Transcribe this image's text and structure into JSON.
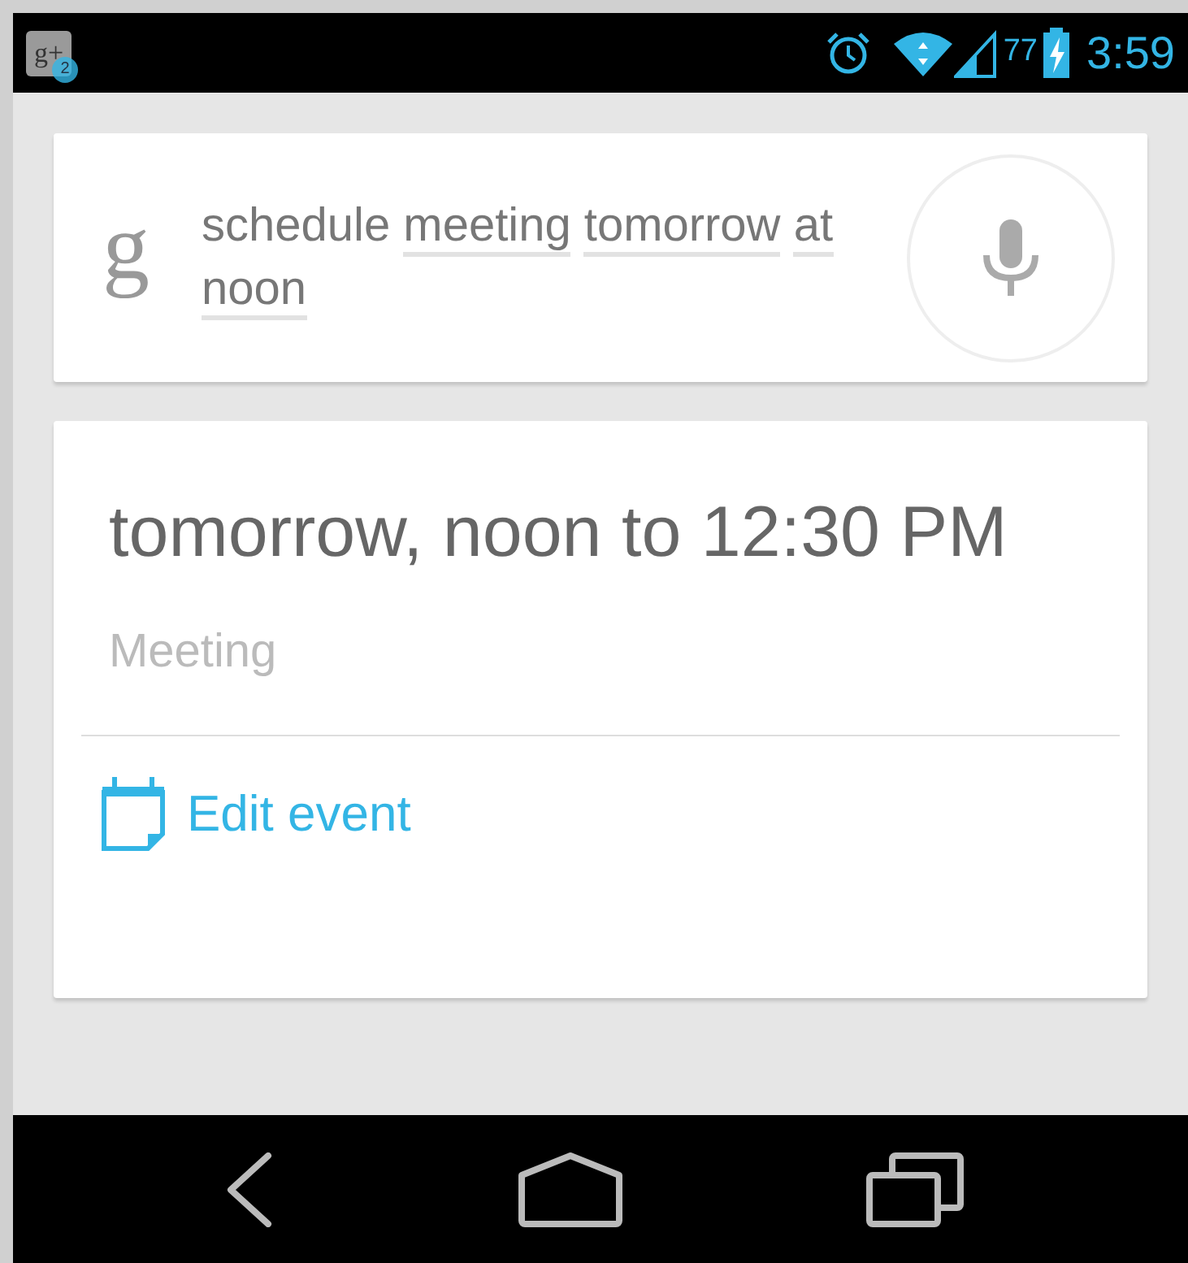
{
  "status_bar": {
    "notification": {
      "label": "g+",
      "count": "2"
    },
    "battery": "77",
    "time": "3:59"
  },
  "search": {
    "logo": "g",
    "words": [
      {
        "text": "schedule",
        "underlined": false
      },
      {
        "text": "meeting",
        "underlined": true
      },
      {
        "text": "tomorrow",
        "underlined": true
      },
      {
        "text": "at",
        "underlined": true
      },
      {
        "text": "noon",
        "underlined": true
      }
    ]
  },
  "event_card": {
    "time": "tomorrow, noon to 12:30 PM",
    "title": "Meeting",
    "action": "Edit event"
  }
}
